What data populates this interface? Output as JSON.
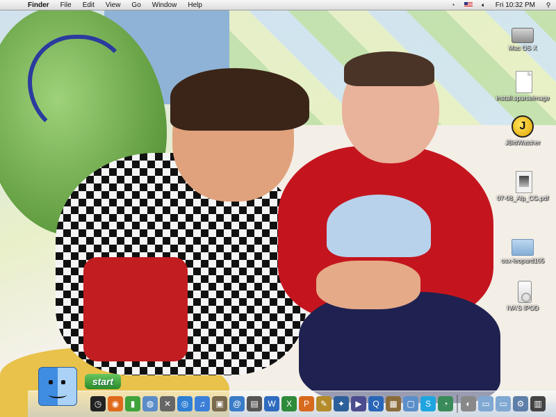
{
  "menubar": {
    "apple_glyph": "",
    "items": [
      "Finder",
      "File",
      "Edit",
      "View",
      "Go",
      "Window",
      "Help"
    ],
    "clock": "Fri 10:32 PM",
    "search_glyph": "⚲"
  },
  "desktop_icons": [
    {
      "label": "Mac OS X",
      "icon": "hard-drive-icon"
    },
    {
      "label": "install.sparseimage",
      "icon": "document-icon"
    },
    {
      "label": "JBidWatcher",
      "icon": "jbidwatcher-icon"
    },
    {
      "label": "07-08_Alp_CG.pdf",
      "icon": "pdf-icon"
    },
    {
      "label": "osx-leopard105",
      "icon": "folder-icon"
    },
    {
      "label": "IVA'S IPOD",
      "icon": "ipod-icon"
    }
  ],
  "start": {
    "label": "start"
  },
  "dock": {
    "apps": [
      {
        "name": "dashboard",
        "glyph": "◷",
        "color": "#222"
      },
      {
        "name": "firefox",
        "glyph": "◉",
        "color": "#e06a1b"
      },
      {
        "name": "battery-app",
        "glyph": "▮",
        "color": "#3fa33a"
      },
      {
        "name": "network-app",
        "glyph": "◍",
        "color": "#5b8cc8"
      },
      {
        "name": "xcode",
        "glyph": "✕",
        "color": "#666"
      },
      {
        "name": "safari",
        "glyph": "◎",
        "color": "#2e7fd5"
      },
      {
        "name": "itunes",
        "glyph": "♫",
        "color": "#3b7fd9"
      },
      {
        "name": "iphoto",
        "glyph": "▣",
        "color": "#7a6a4e"
      },
      {
        "name": "mail",
        "glyph": "@",
        "color": "#3a7cc7"
      },
      {
        "name": "preview",
        "glyph": "▤",
        "color": "#555"
      },
      {
        "name": "word",
        "glyph": "W",
        "color": "#2f6bbf"
      },
      {
        "name": "excel",
        "glyph": "X",
        "color": "#2e8b3a"
      },
      {
        "name": "powerpoint",
        "glyph": "P",
        "color": "#d86a1e"
      },
      {
        "name": "paint-app",
        "glyph": "✎",
        "color": "#b38b2a"
      },
      {
        "name": "photoshop",
        "glyph": "✦",
        "color": "#2d5f9a"
      },
      {
        "name": "imovie",
        "glyph": "▶",
        "color": "#4b4b8f"
      },
      {
        "name": "quicktime",
        "glyph": "Q",
        "color": "#2a66b8"
      },
      {
        "name": "photos-app",
        "glyph": "▦",
        "color": "#8a6b3a"
      },
      {
        "name": "finder-window",
        "glyph": "▢",
        "color": "#5b8fc9"
      },
      {
        "name": "skype",
        "glyph": "S",
        "color": "#1ea5e0"
      },
      {
        "name": "time-machine",
        "glyph": "◔",
        "color": "#3a8b5a"
      }
    ],
    "right": [
      {
        "name": "applications-stack",
        "glyph": "◐",
        "color": "#888"
      },
      {
        "name": "documents-stack",
        "glyph": "▭",
        "color": "#7fa8d2"
      },
      {
        "name": "downloads-stack",
        "glyph": "▭",
        "color": "#7fa8d2"
      },
      {
        "name": "system-prefs",
        "glyph": "⚙",
        "color": "#5e7fa8"
      },
      {
        "name": "trash",
        "glyph": "▥",
        "color": "#444"
      }
    ]
  }
}
